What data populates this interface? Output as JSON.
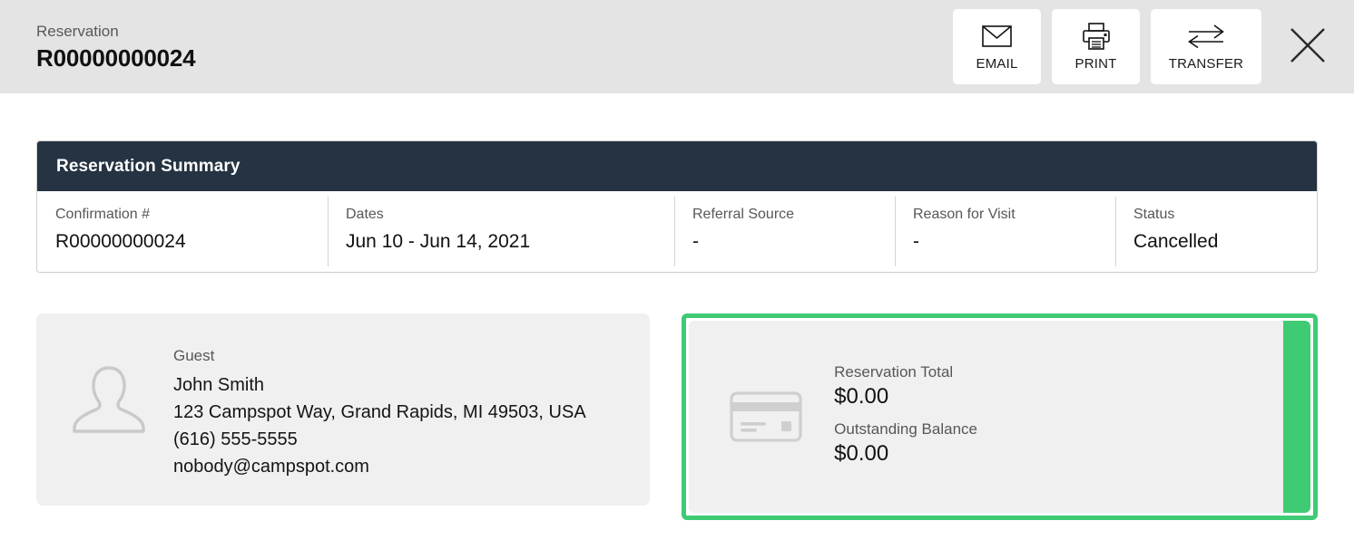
{
  "header": {
    "eyebrow": "Reservation",
    "title": "R00000000024",
    "actions": [
      {
        "label": "EMAIL",
        "icon": "envelope-icon"
      },
      {
        "label": "PRINT",
        "icon": "printer-icon"
      },
      {
        "label": "TRANSFER",
        "icon": "transfer-arrows-icon"
      }
    ],
    "close_icon": "close-icon"
  },
  "summary": {
    "title": "Reservation Summary",
    "fields": [
      {
        "label": "Confirmation #",
        "value": "R00000000024"
      },
      {
        "label": "Dates",
        "value": "Jun 10 - Jun 14, 2021"
      },
      {
        "label": "Referral Source",
        "value": "-"
      },
      {
        "label": "Reason for Visit",
        "value": "-"
      },
      {
        "label": "Status",
        "value": "Cancelled"
      }
    ]
  },
  "guest": {
    "label": "Guest",
    "name": "John Smith",
    "address": "123 Campspot Way, Grand Rapids, MI 49503, USA",
    "phone": "(616) 555-5555",
    "email": "nobody@campspot.com",
    "avatar_icon": "person-silhouette-icon"
  },
  "payment": {
    "card_icon": "credit-card-icon",
    "total_label": "Reservation Total",
    "total_value": "$0.00",
    "balance_label": "Outstanding Balance",
    "balance_value": "$0.00"
  },
  "colors": {
    "header_bg": "#e4e4e4",
    "summary_header_bg": "#253342",
    "accent_green": "#3ecb74",
    "card_bg": "#f0f0f0",
    "page_bg": "#ffffff",
    "muted_text": "#575757"
  }
}
